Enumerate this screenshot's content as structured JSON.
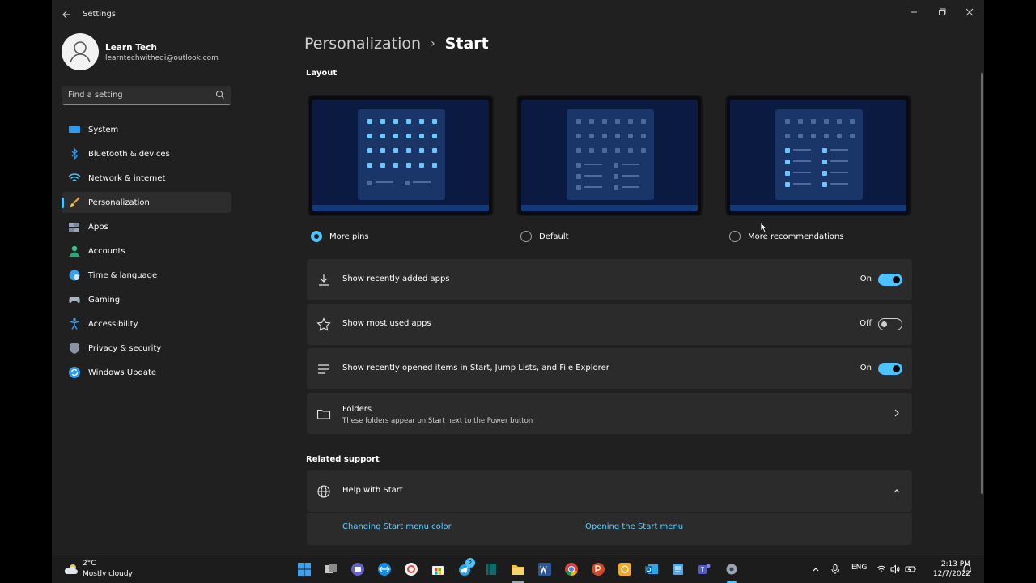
{
  "window": {
    "title": "Settings"
  },
  "profile": {
    "name": "Learn Tech",
    "email": "learntechwithedi@outlook.com"
  },
  "search": {
    "placeholder": "Find a setting"
  },
  "sidebar": {
    "items": [
      {
        "label": "System",
        "icon": "monitor-icon",
        "active": false
      },
      {
        "label": "Bluetooth & devices",
        "icon": "bluetooth-icon",
        "active": false
      },
      {
        "label": "Network & internet",
        "icon": "wifi-icon",
        "active": false
      },
      {
        "label": "Personalization",
        "icon": "brush-icon",
        "active": true
      },
      {
        "label": "Apps",
        "icon": "apps-icon",
        "active": false
      },
      {
        "label": "Accounts",
        "icon": "person-icon",
        "active": false
      },
      {
        "label": "Time & language",
        "icon": "globe-clock-icon",
        "active": false
      },
      {
        "label": "Gaming",
        "icon": "gamepad-icon",
        "active": false
      },
      {
        "label": "Accessibility",
        "icon": "accessibility-icon",
        "active": false
      },
      {
        "label": "Privacy & security",
        "icon": "shield-icon",
        "active": false
      },
      {
        "label": "Windows Update",
        "icon": "update-icon",
        "active": false
      }
    ]
  },
  "breadcrumb": {
    "parent": "Personalization",
    "separator": "›",
    "current": "Start"
  },
  "layout": {
    "section_label": "Layout",
    "options": [
      {
        "label": "More pins",
        "selected": true
      },
      {
        "label": "Default",
        "selected": false
      },
      {
        "label": "More recommendations",
        "selected": false
      }
    ]
  },
  "settings": [
    {
      "label": "Show recently added apps",
      "state": "On",
      "on": true,
      "icon": "download-icon"
    },
    {
      "label": "Show most used apps",
      "state": "Off",
      "on": false,
      "icon": "star-icon"
    },
    {
      "label": "Show recently opened items in Start, Jump Lists, and File Explorer",
      "state": "On",
      "on": true,
      "icon": "list-icon"
    }
  ],
  "folders": {
    "label": "Folders",
    "description": "These folders appear on Start next to the Power button"
  },
  "related": {
    "section_label": "Related support",
    "help_label": "Help with Start",
    "links": [
      "Changing Start menu color",
      "Opening the Start menu"
    ]
  },
  "taskbar": {
    "weather_temp": "2°C",
    "weather_desc": "Mostly cloudy",
    "language": "ENG",
    "time": "2:13 PM",
    "date": "12/7/2022",
    "badge_count": "2"
  },
  "colors": {
    "accent": "#4cc2ff",
    "link": "#60cdff",
    "window_bg": "#202020",
    "card_bg": "#2b2b2b"
  }
}
